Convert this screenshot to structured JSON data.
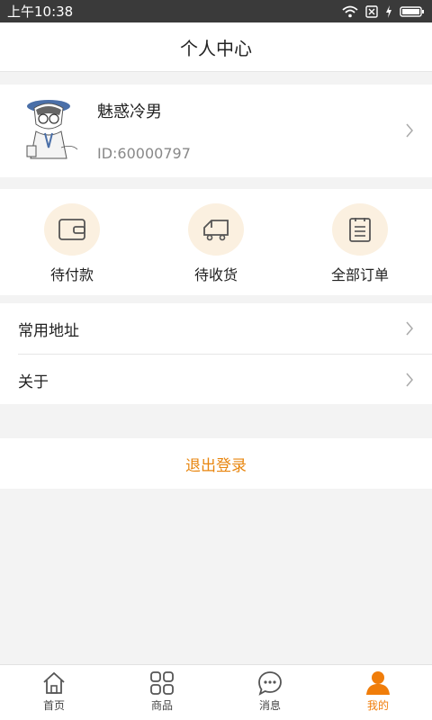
{
  "status_bar": {
    "time": "上午10:38"
  },
  "header": {
    "title": "个人中心"
  },
  "profile": {
    "name": "魅惑冷男",
    "id_text": "ID:60000797"
  },
  "orders": [
    {
      "label": "待付款",
      "icon": "wallet-icon"
    },
    {
      "label": "待收货",
      "icon": "truck-icon"
    },
    {
      "label": "全部订单",
      "icon": "order-list-icon"
    }
  ],
  "menu": [
    {
      "label": "常用地址"
    },
    {
      "label": "关于"
    }
  ],
  "logout_label": "退出登录",
  "tabs": [
    {
      "label": "首页",
      "icon": "home-icon"
    },
    {
      "label": "商品",
      "icon": "grid-icon"
    },
    {
      "label": "消息",
      "icon": "chat-icon"
    },
    {
      "label": "我的",
      "icon": "user-icon",
      "active": true
    }
  ],
  "colors": {
    "accent": "#f07d0a",
    "icon_bg": "#fbf0e0",
    "logout": "#e8860f"
  }
}
